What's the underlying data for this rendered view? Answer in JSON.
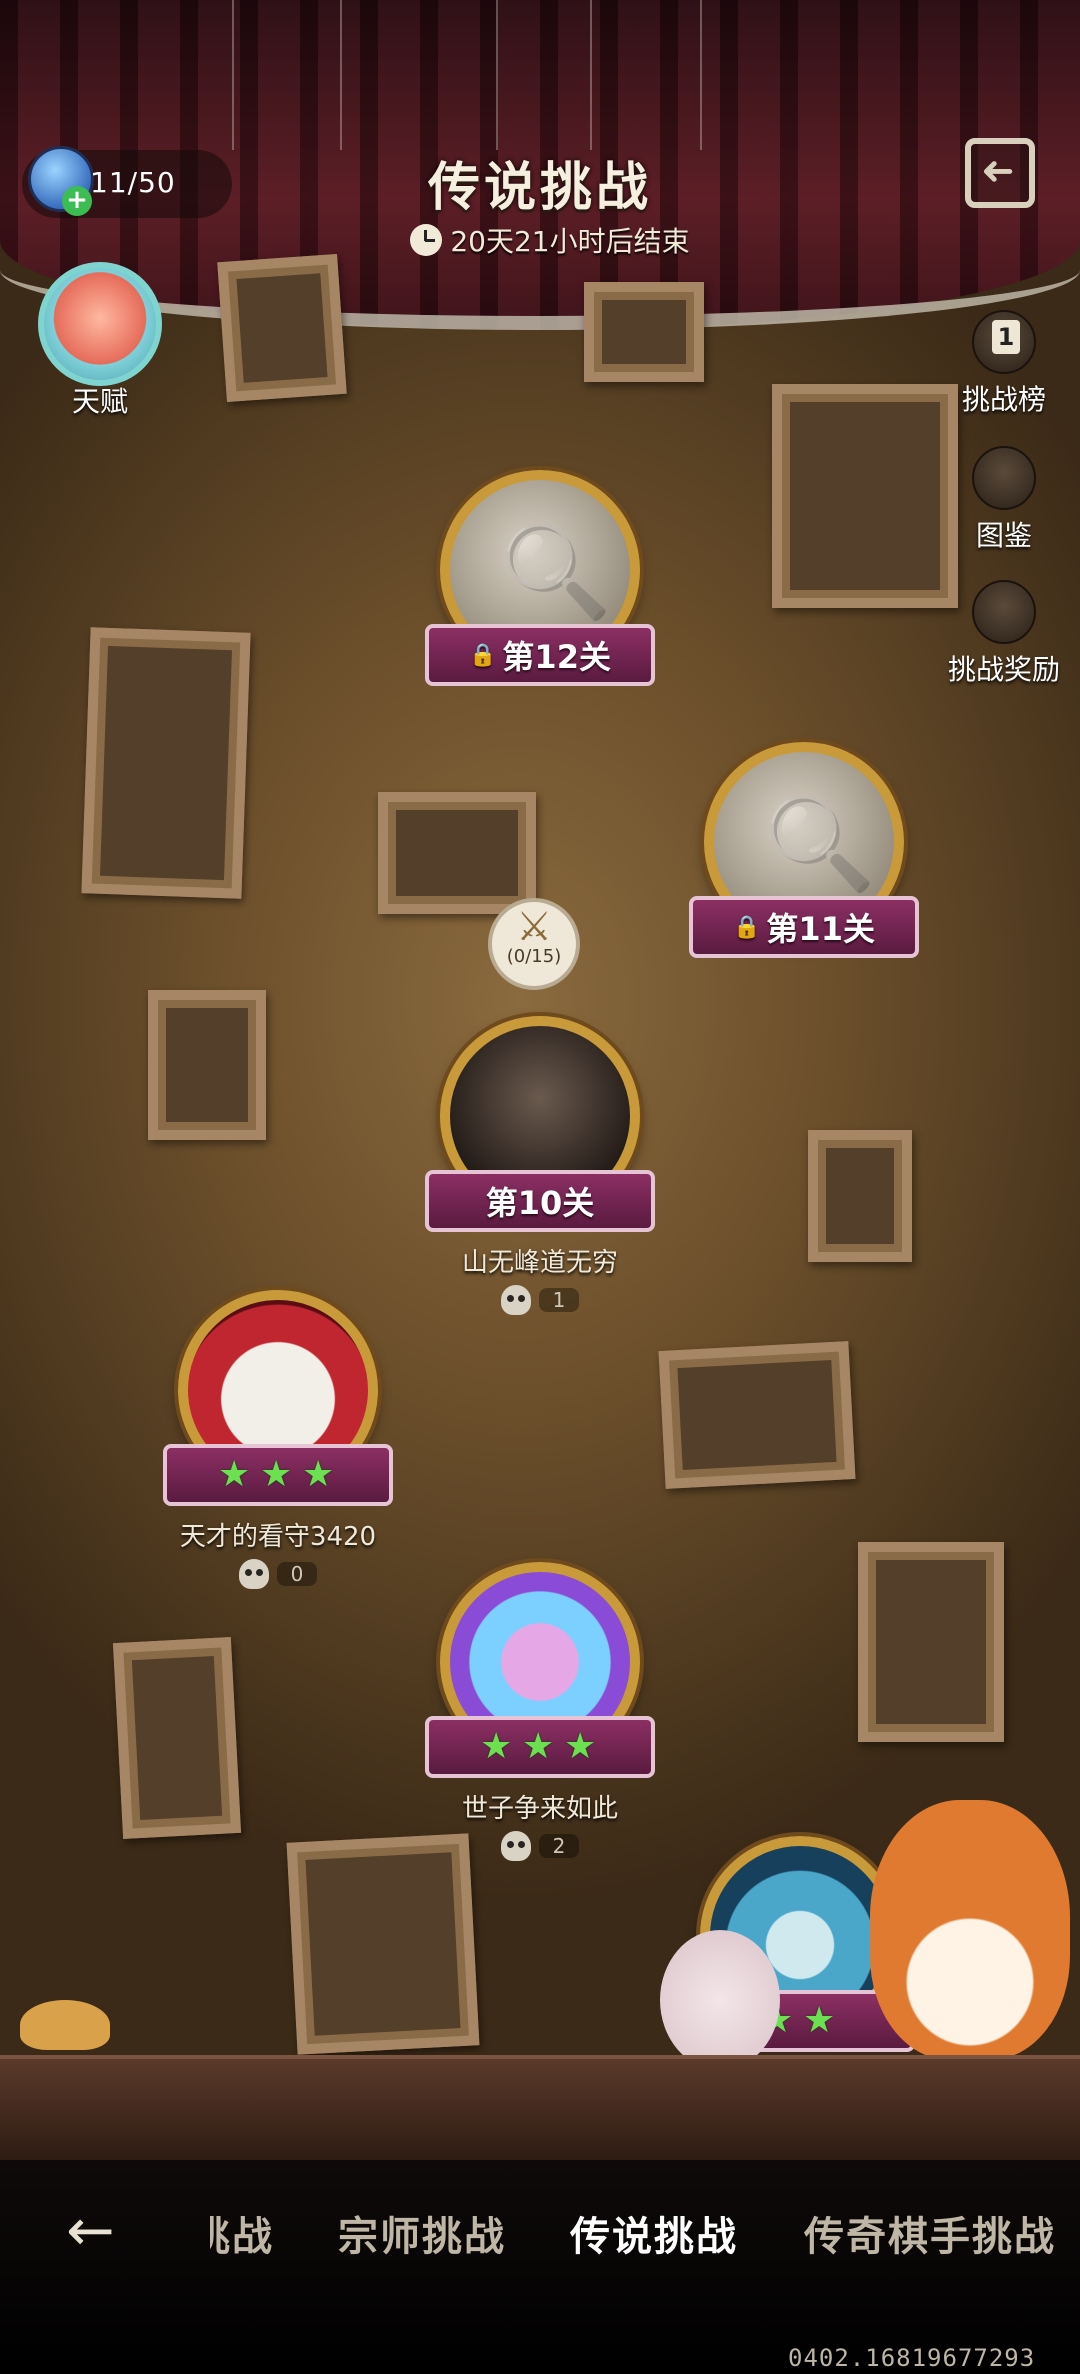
{
  "header": {
    "stamina": "11/50",
    "title": "传说挑战",
    "timer": "20天21小时后结束"
  },
  "talent": {
    "label": "天赋"
  },
  "side_menu": {
    "leaderboard": {
      "badge": "1",
      "label": "挑战榜"
    },
    "codex": {
      "label": "图鉴"
    },
    "rewards": {
      "label": "挑战奖励"
    }
  },
  "challenge_bubble": {
    "count": "(0/15)"
  },
  "stages": [
    {
      "label": "第12关",
      "locked": true
    },
    {
      "label": "第11关",
      "locked": true
    },
    {
      "label": "第10关",
      "name": "山无峰道无穷",
      "deaths": "1"
    },
    {
      "stars": 3,
      "name": "天才的看守3420",
      "deaths": "0"
    },
    {
      "stars": 3,
      "name": "世子争来如此",
      "deaths": "2"
    },
    {
      "stars": 2
    }
  ],
  "bottom_nav": {
    "tabs": [
      "挑战",
      "宗师挑战",
      "传说挑战",
      "传奇棋手挑战"
    ],
    "active": "传说挑战"
  },
  "build_id": "0402.16819677293",
  "colors": {
    "ribbon": "#8c2f63",
    "medal_rim": "#c99a3a",
    "star": "#6de052",
    "curtain": "#5a1a22"
  }
}
